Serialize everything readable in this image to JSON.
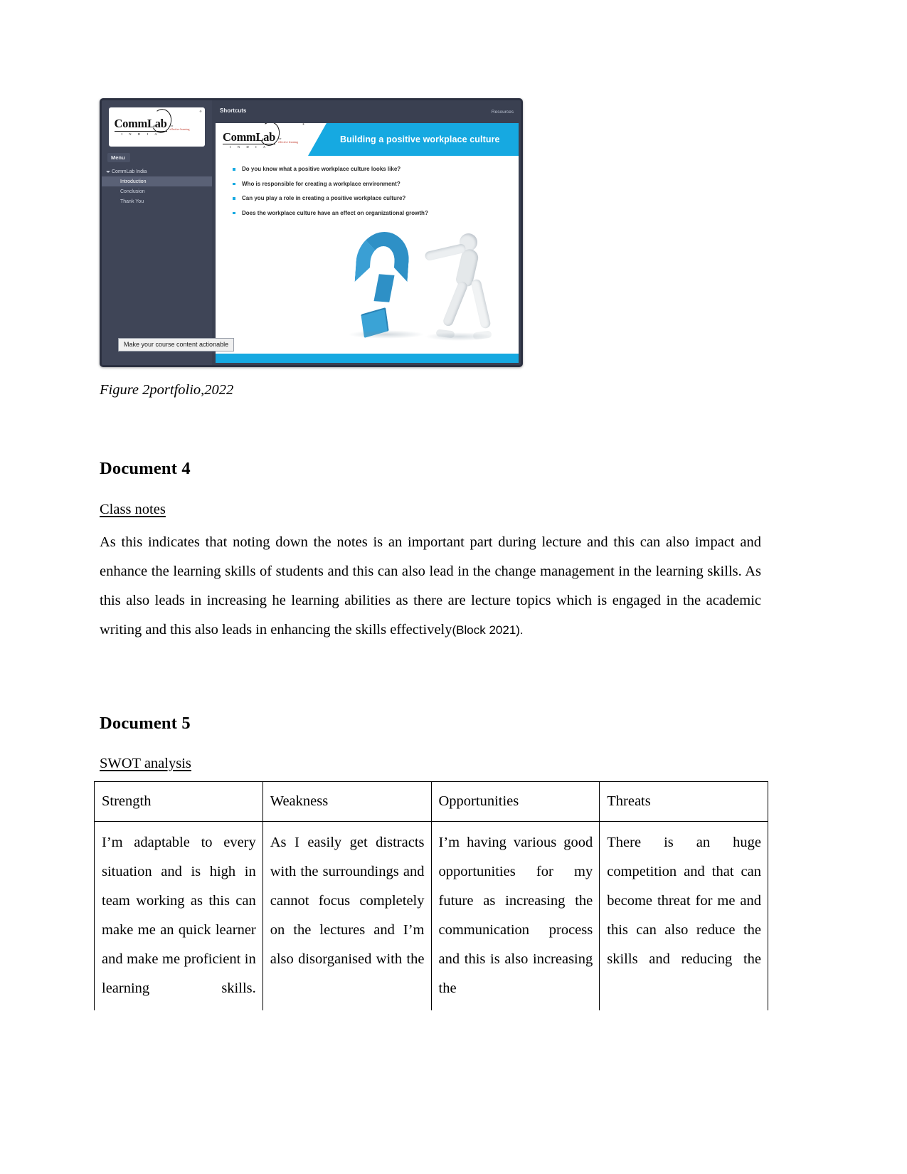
{
  "figure": {
    "caption": "Figure 2portfolio,2022",
    "elearning": {
      "sidebar": {
        "logo_main": "CommLab",
        "logo_sub": "I N D I A",
        "logo_tagline_1": "for",
        "logo_tagline_2": "effective learning",
        "menu_label": "Menu",
        "tree_root": "CommLab India",
        "tree_items": [
          {
            "label": "Introduction",
            "active": true
          },
          {
            "label": "Conclusion",
            "active": false
          },
          {
            "label": "Thank You",
            "active": false
          }
        ]
      },
      "topbar": {
        "shortcuts": "Shortcuts",
        "resources": "Resources"
      },
      "slide": {
        "title": "Building a positive workplace culture",
        "bullets": [
          "Do you know what a positive workplace culture looks like?",
          "Who is responsible for creating a workplace environment?",
          "Can you play a role in creating a positive workplace culture?",
          "Does the workplace culture have an effect on organizational growth?"
        ]
      },
      "tooltip": "Make your course content actionable",
      "accent_color": "#16a9e1",
      "chrome_color": "#3a4051"
    }
  },
  "document4": {
    "heading": "Document 4",
    "subheading": "Class notes",
    "paragraph": "As this indicates that noting down the notes is an important part during lecture and this can also impact and enhance the learning skills of students and this can also lead in the change management in the learning skills. As this also leads in increasing he learning abilities as there are lecture topics which is engaged in the academic writing and this also leads in enhancing the skills effectively",
    "citation": "(Block  2021)."
  },
  "document5": {
    "heading": "Document 5",
    "subheading": "SWOT analysis",
    "table": {
      "headers": [
        "Strength",
        "Weakness",
        "Opportunities",
        "Threats"
      ],
      "rows": [
        [
          "I’m adaptable to every situation and is high in team working as this can make me an quick learner and make me proficient in learning skills.",
          "As I easily get distracts with the surroundings and cannot focus completely on the lectures and I’m also disorganised with the",
          "I’m having various good opportunities for my future as increasing the communication process and this is also increasing the",
          "There is an huge competition and that can become threat for me and this can also reduce the skills and reducing the"
        ]
      ]
    }
  }
}
